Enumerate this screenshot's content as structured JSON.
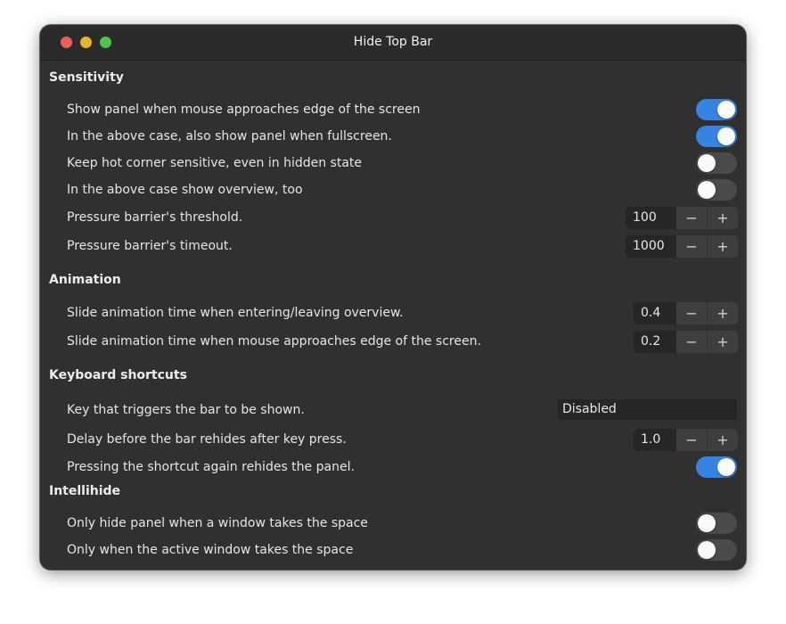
{
  "window": {
    "title": "Hide Top Bar"
  },
  "sections": {
    "sensitivity": {
      "title": "Sensitivity",
      "show_panel_edge": {
        "label": "Show panel when mouse approaches edge of the screen",
        "on": true
      },
      "show_panel_fullscreen": {
        "label": "In the above case, also show panel when fullscreen.",
        "on": true
      },
      "hot_corner": {
        "label": "Keep hot corner sensitive, even in hidden state",
        "on": false
      },
      "show_overview": {
        "label": "In the above case show overview, too",
        "on": false
      },
      "pressure_threshold": {
        "label": "Pressure barrier's threshold.",
        "value": "100"
      },
      "pressure_timeout": {
        "label": "Pressure barrier's timeout.",
        "value": "1000"
      }
    },
    "animation": {
      "title": "Animation",
      "slide_overview": {
        "label": "Slide animation time when entering/leaving overview.",
        "value": "0.4"
      },
      "slide_edge": {
        "label": "Slide animation time when mouse approaches edge of the screen.",
        "value": "0.2"
      }
    },
    "keyboard": {
      "title": "Keyboard shortcuts",
      "trigger_key": {
        "label": "Key that triggers the bar to be shown.",
        "value": "Disabled"
      },
      "rehide_delay": {
        "label": "Delay before the bar rehides after key press.",
        "value": "1.0"
      },
      "shortcut_rehides": {
        "label": "Pressing the shortcut again rehides the panel.",
        "on": true
      }
    },
    "intellihide": {
      "title": "Intellihide",
      "window_takes_space": {
        "label": "Only hide panel when a window takes the space",
        "on": false
      },
      "active_window": {
        "label": "Only when the active window takes the space",
        "on": false
      }
    }
  },
  "spin_buttons": {
    "minus": "−",
    "plus": "+"
  },
  "colors": {
    "accent": "#3584e4",
    "window_bg": "#303030",
    "switch_off": "#4a4a4a"
  }
}
